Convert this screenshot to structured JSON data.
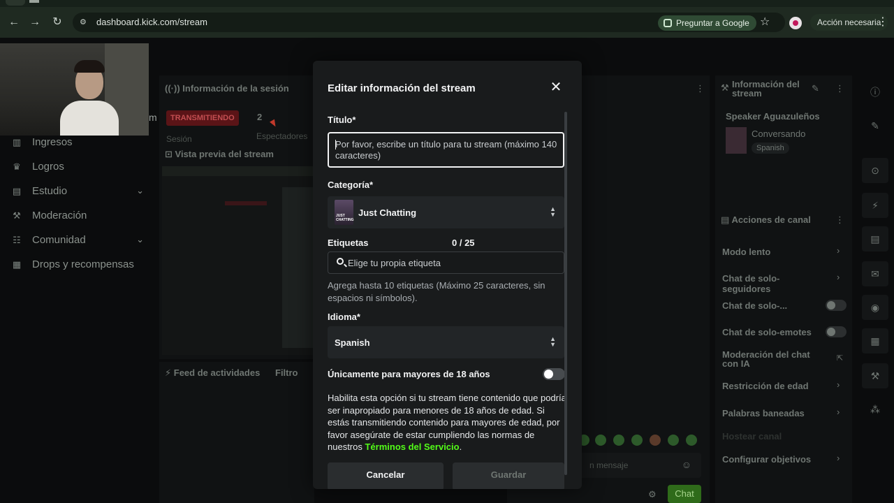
{
  "browser": {
    "url": "dashboard.kick.com/stream",
    "ask_google": "Preguntar a Google",
    "action_needed": "Acción necesaria"
  },
  "sidebar": {
    "items": [
      {
        "label": "Ingresos",
        "icon": "revenue-icon"
      },
      {
        "label": "Logros",
        "icon": "trophy-icon"
      },
      {
        "label": "Estudio",
        "icon": "studio-icon",
        "expandable": true
      },
      {
        "label": "Moderación",
        "icon": "wrench-icon"
      },
      {
        "label": "Comunidad",
        "icon": "community-icon",
        "expandable": true
      },
      {
        "label": "Drops y recompensas",
        "icon": "drops-icon"
      }
    ],
    "partial_letter": "m"
  },
  "session": {
    "title": "Información de la sesión",
    "status": "TRANSMITIENDO",
    "viewers": "2",
    "session_label": "Sesión",
    "viewers_label": "Espectadores"
  },
  "preview": {
    "title": "Vista previa del stream"
  },
  "feed": {
    "title": "Feed de actividades",
    "filter": "Filtro"
  },
  "chat": {
    "placeholder": "n mensaje",
    "send": "Chat"
  },
  "stream_info": {
    "title": "Información del stream",
    "stream_title": "Speaker Aguazuleños",
    "category": "Conversando",
    "language": "Spanish"
  },
  "channel_actions": {
    "title": "Acciones de canal",
    "items": [
      {
        "label": "Modo lento",
        "control": "chevron"
      },
      {
        "label": "Chat de solo-seguidores",
        "control": "chevron"
      },
      {
        "label": "Chat de solo-...",
        "control": "toggle"
      },
      {
        "label": "Chat de solo-emotes",
        "control": "toggle"
      },
      {
        "label": "Moderación del chat con IA",
        "control": "external"
      },
      {
        "label": "Restricción de edad",
        "control": "chevron"
      },
      {
        "label": "Palabras baneadas",
        "control": "chevron"
      },
      {
        "label": "Hostear canal",
        "control": "none"
      },
      {
        "label": "Configurar objetivos",
        "control": "chevron"
      }
    ]
  },
  "modal": {
    "title": "Editar información del stream",
    "title_label": "Título*",
    "title_placeholder": "Por favor, escribe un título para tu stream (máximo 140 caracteres)",
    "category_label": "Categoría*",
    "category_value": "Just Chatting",
    "category_thumb_text": "JUST CHATTING",
    "tags_label": "Etiquetas",
    "tags_counter": "0 / 25",
    "tags_placeholder": "Elige tu propia etiqueta",
    "tags_help": "Agrega hasta 10 etiquetas (Máximo 25 caracteres, sin espacios ni símbolos).",
    "language_label": "Idioma*",
    "language_value": "Spanish",
    "adult_label": "Únicamente para mayores de 18 años",
    "adult_enabled": false,
    "adult_help": "Habilita esta opción si tu stream tiene contenido que podría ser inapropiado para menores de 18 años de edad. Si estás transmitiendo contenido para mayores de edad, por favor asegúrate de estar cumpliendo las normas de nuestros ",
    "adult_help_link": "Términos del Servicio",
    "adult_help_end": ".",
    "cancel": "Cancelar",
    "save": "Guardar"
  },
  "colors": {
    "accent": "#53fc18",
    "live_badge": "#5a1417",
    "modal_bg": "#191b1c"
  }
}
